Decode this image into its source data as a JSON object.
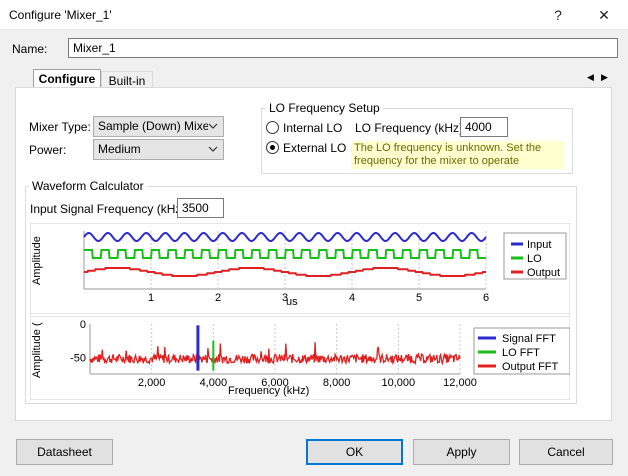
{
  "window": {
    "title": "Configure 'Mixer_1'",
    "help_glyph": "?",
    "close_glyph": "✕"
  },
  "name": {
    "label": "Name:",
    "value": "Mixer_1"
  },
  "tabs": [
    {
      "label": "Configure",
      "active": true
    },
    {
      "label": "Built-in",
      "active": false
    }
  ],
  "configure": {
    "mixer_type": {
      "label": "Mixer Type:",
      "value": "Sample (Down) Mixer"
    },
    "power": {
      "label": "Power:",
      "value": "Medium"
    },
    "lo_setup": {
      "title": "LO Frequency Setup",
      "internal_label": "Internal LO",
      "external_label": "External LO",
      "selected": "External LO",
      "lo_freq_label": "LO Frequency (kHz):",
      "lo_freq_value": "4000",
      "note": "The LO frequency is unknown. Set the frequency for the mixer to operate"
    },
    "waveform": {
      "title": "Waveform Calculator",
      "input_freq_label": "Input Signal Frequency (kHz):",
      "input_freq_value": "3500"
    }
  },
  "chart_data": [
    {
      "type": "line",
      "ylabel": "Amplitude",
      "xlabel": "us",
      "xlim": [
        0,
        6
      ],
      "x_ticks": [
        "1",
        "2",
        "3",
        "4",
        "5",
        "6"
      ],
      "series": [
        {
          "name": "Input",
          "color": "#2a2ad0",
          "shape": "sine",
          "frequency_mhz": 3.5
        },
        {
          "name": "LO",
          "color": "#16c016",
          "shape": "square",
          "frequency_mhz": 4.0
        },
        {
          "name": "Output",
          "color": "#e02020",
          "shape": "steps",
          "frequency_mhz": 0.5
        }
      ]
    },
    {
      "type": "line",
      "ylabel": "Amplitude (",
      "xlabel": "Frequency (kHz)",
      "xlim": [
        0,
        12000
      ],
      "ylim": [
        -75,
        0
      ],
      "x_ticks": [
        "2,000",
        "4,000",
        "6,000",
        "8,000",
        "10,000",
        "12,000"
      ],
      "y_ticks": [
        "0",
        "-50"
      ],
      "series": [
        {
          "name": "Signal FFT",
          "color": "#2a2ad0",
          "peak_khz": 3500
        },
        {
          "name": "LO FFT",
          "color": "#16c016",
          "peak_khz": 4000
        },
        {
          "name": "Output FFT",
          "color": "#e02020",
          "noise_floor_db": -52
        }
      ]
    }
  ],
  "tab_nav": {
    "prev": "◀",
    "next": "▶"
  },
  "buttons": {
    "datasheet": "Datasheet",
    "ok": "OK",
    "apply": "Apply",
    "cancel": "Cancel"
  }
}
